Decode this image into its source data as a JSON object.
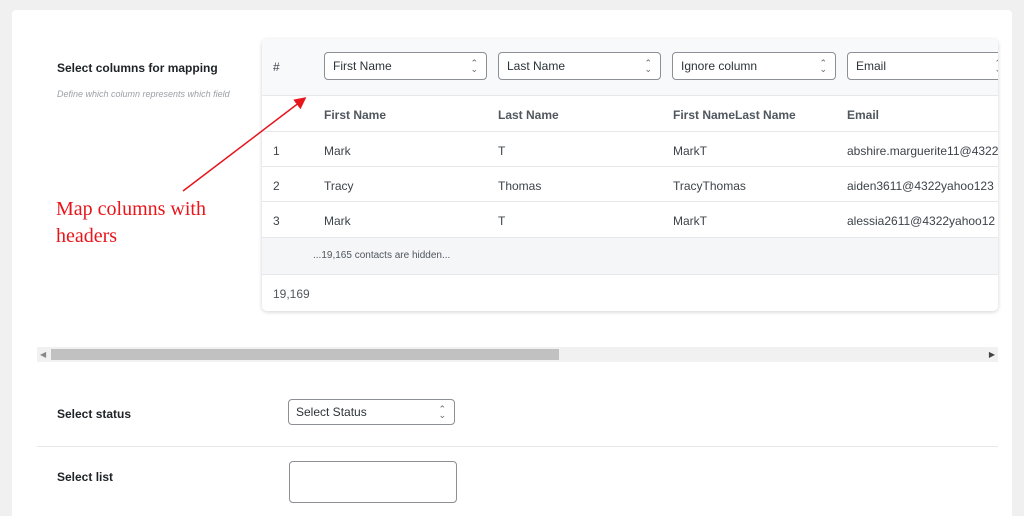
{
  "mapping": {
    "label": "Select columns for mapping",
    "description": "Define which column represents which field"
  },
  "table": {
    "hash": "#",
    "selects": [
      "First Name",
      "Last Name",
      "Ignore column",
      "Email"
    ],
    "headers": [
      "First Name",
      "Last Name",
      "First NameLast Name",
      "Email"
    ],
    "rows": [
      {
        "num": "1",
        "cells": [
          "Mark",
          "T",
          "MarkT",
          "abshire.marguerite11@4322"
        ]
      },
      {
        "num": "2",
        "cells": [
          "Tracy",
          "Thomas",
          "TracyThomas",
          "aiden3611@4322yahoo123"
        ]
      },
      {
        "num": "3",
        "cells": [
          "Mark",
          "T",
          "MarkT",
          "alessia2611@4322yahoo12"
        ]
      }
    ],
    "hidden_note": "...19,165 contacts are hidden...",
    "total": "19,169"
  },
  "status": {
    "label": "Select status",
    "select_value": "Select Status"
  },
  "list": {
    "label": "Select list"
  },
  "annotation": {
    "text": "Map columns with headers",
    "color": "#e8151b"
  },
  "icons": {
    "select_chevron": "chevron-updown-icon",
    "scroll_left": "arrow-left-icon",
    "scroll_right": "arrow-right-icon"
  }
}
